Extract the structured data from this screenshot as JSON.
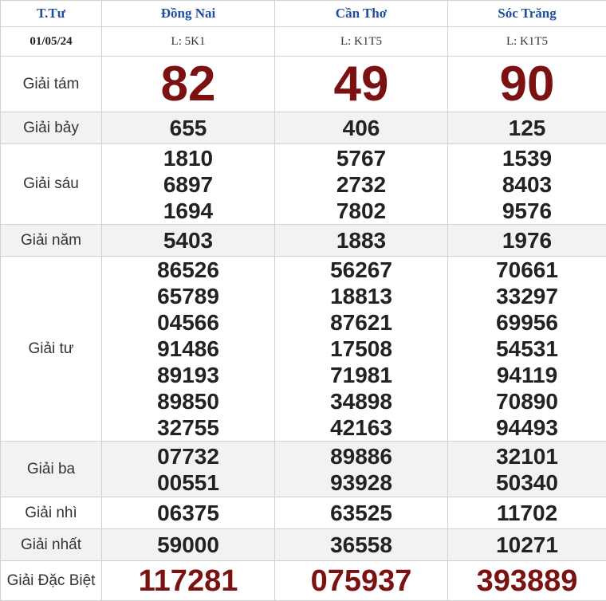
{
  "header": {
    "weekday": "T.Tư",
    "date": "01/05/24",
    "provinces": [
      {
        "name": "Đồng Nai",
        "code": "L: 5K1"
      },
      {
        "name": "Cần Thơ",
        "code": "L: K1T5"
      },
      {
        "name": "Sóc Trăng",
        "code": "L: K1T5"
      }
    ]
  },
  "prizes": {
    "g8": {
      "label": "Giải tám",
      "values": [
        "82",
        "49",
        "90"
      ]
    },
    "g7": {
      "label": "Giải bảy",
      "values": [
        "655",
        "406",
        "125"
      ]
    },
    "g6": {
      "label": "Giải sáu",
      "values": [
        [
          "1810",
          "6897",
          "1694"
        ],
        [
          "5767",
          "2732",
          "7802"
        ],
        [
          "1539",
          "8403",
          "9576"
        ]
      ]
    },
    "g5": {
      "label": "Giải năm",
      "values": [
        "5403",
        "1883",
        "1976"
      ]
    },
    "g4": {
      "label": "Giải tư",
      "values": [
        [
          "86526",
          "65789",
          "04566",
          "91486",
          "89193",
          "89850",
          "32755"
        ],
        [
          "56267",
          "18813",
          "87621",
          "17508",
          "71981",
          "34898",
          "42163"
        ],
        [
          "70661",
          "33297",
          "69956",
          "54531",
          "94119",
          "70890",
          "94493"
        ]
      ]
    },
    "g3": {
      "label": "Giải ba",
      "values": [
        [
          "07732",
          "00551"
        ],
        [
          "89886",
          "93928"
        ],
        [
          "32101",
          "50340"
        ]
      ]
    },
    "g2": {
      "label": "Giải nhì",
      "values": [
        "06375",
        "63525",
        "11702"
      ]
    },
    "g1": {
      "label": "Giải nhất",
      "values": [
        "59000",
        "36558",
        "10271"
      ]
    },
    "db": {
      "label": "Giải Đặc Biệt",
      "values": [
        "117281",
        "075937",
        "393889"
      ]
    }
  },
  "colors": {
    "header_text": "#1f4e9c",
    "highlight": "#7b1111",
    "shade": "#f2f2f2"
  }
}
